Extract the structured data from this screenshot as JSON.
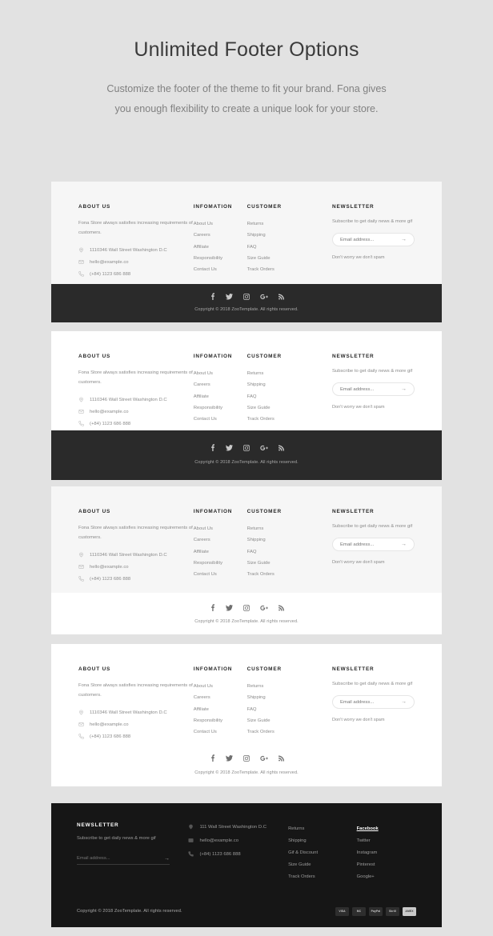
{
  "header": {
    "title": "Unlimited Footer Options",
    "subtitle": "Customize the footer of the theme to fit your brand. Fona gives you enough flexibility to create a unique look for your store."
  },
  "footer": {
    "about": {
      "title": "ABOUT US",
      "text": "Fona Store always satisfies increasing requirements of customers.",
      "address": "1110346 Wall Street Washington D.C",
      "email": "hello@example.co",
      "phone": "(+84) 1123 686 888"
    },
    "information": {
      "title": "INFOMATION",
      "links": [
        "About Us",
        "Careers",
        "Affiliate",
        "Responsibility",
        "Contact Us"
      ]
    },
    "customer": {
      "title": "CUSTOMER",
      "links": [
        "Returns",
        "Shipping",
        "FAQ",
        "Size Guide",
        "Track Orders"
      ]
    },
    "newsletter": {
      "title": "NEWSLETTER",
      "subtitle": "Subscribe to get daily news & more gif",
      "placeholder": "Email address...",
      "value": "",
      "submit": "→",
      "note": "Don't worry we don't spam"
    },
    "socials": [
      "facebook-icon",
      "twitter-icon",
      "instagram-icon",
      "google-plus-icon",
      "rss-icon"
    ],
    "copyright": "Copyright © 2018  ZooTemplate. All rights reserved."
  },
  "dark_footer": {
    "newsletter": {
      "title": "NEWSLETTER",
      "subtitle": "Subscribe to get daily news & more gif",
      "placeholder": "Email address...",
      "value": "",
      "submit": "→"
    },
    "contact": {
      "address": "111 Wall Street Washington D.C",
      "email": "hello@example.co",
      "phone": "(+84) 1123 686 888"
    },
    "links": [
      "Returns",
      "Shipping",
      "Gif & Discount",
      "Size Guide",
      "Track Orders"
    ],
    "social_links": [
      "Facebook",
      "Twitter",
      "Instagram",
      "Pinterest",
      "Google+"
    ],
    "copyright": "Copyright © 2018  ZooTemplate. All rights reserved.",
    "payments": [
      "VISA",
      "MC",
      "PayPal",
      "Skrill",
      "AMEX"
    ]
  },
  "colors": {
    "page_bg": "#e2e2e2",
    "panel_light": "#f6f6f6",
    "panel_white": "#ffffff",
    "bar_dark": "#2a2a2a",
    "footer_dark": "#161616",
    "text_muted": "#8b8b8b",
    "text_dark": "#272727"
  }
}
